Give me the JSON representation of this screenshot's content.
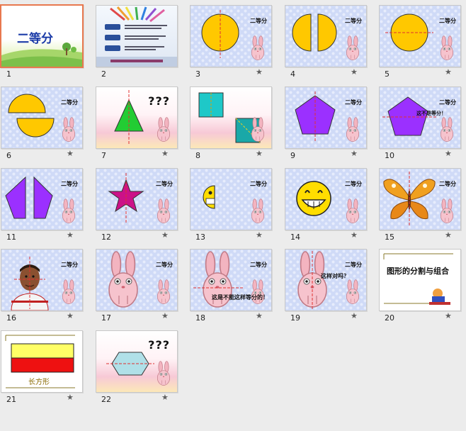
{
  "slides": [
    {
      "number": "1",
      "kind": "title",
      "title_text": "二等分",
      "selected": true,
      "has_anim": false
    },
    {
      "number": "2",
      "kind": "menu",
      "selected": false,
      "has_anim": false
    },
    {
      "number": "3",
      "kind": "circle-whole",
      "corner_label": "二等分",
      "selected": false,
      "has_anim": true
    },
    {
      "number": "4",
      "kind": "circle-split-v",
      "corner_label": "二等分",
      "selected": false,
      "has_anim": true
    },
    {
      "number": "5",
      "kind": "circle-h",
      "corner_label": "二等分",
      "selected": false,
      "has_anim": true
    },
    {
      "number": "6",
      "kind": "circle-split-h",
      "corner_label": "二等分",
      "selected": false,
      "has_anim": true
    },
    {
      "number": "7",
      "kind": "triangle",
      "corner_label": "???",
      "selected": false,
      "has_anim": true
    },
    {
      "number": "8",
      "kind": "squares",
      "selected": false,
      "has_anim": true
    },
    {
      "number": "9",
      "kind": "pentagon",
      "corner_label": "二等分",
      "selected": false,
      "has_anim": true
    },
    {
      "number": "10",
      "kind": "pentagon-h",
      "corner_label": "二等分",
      "mid_label": "这不是等分！",
      "selected": false,
      "has_anim": true
    },
    {
      "number": "11",
      "kind": "pentagon-split",
      "corner_label": "二等分",
      "selected": false,
      "has_anim": true
    },
    {
      "number": "12",
      "kind": "star",
      "corner_label": "二等分",
      "selected": false,
      "has_anim": true
    },
    {
      "number": "13",
      "kind": "smiley-half",
      "corner_label": "二等分",
      "selected": false,
      "has_anim": true
    },
    {
      "number": "14",
      "kind": "smiley",
      "corner_label": "二等分",
      "selected": false,
      "has_anim": true
    },
    {
      "number": "15",
      "kind": "butterfly",
      "corner_label": "二等分",
      "selected": false,
      "has_anim": true
    },
    {
      "number": "16",
      "kind": "face",
      "corner_label": "二等分",
      "selected": false,
      "has_anim": true
    },
    {
      "number": "17",
      "kind": "big-bunny",
      "corner_label": "二等分",
      "selected": false,
      "has_anim": true
    },
    {
      "number": "18",
      "kind": "big-bunny-h",
      "corner_label": "二等分",
      "bottom_label": "这是不能这样等分的！",
      "selected": false,
      "has_anim": true
    },
    {
      "number": "19",
      "kind": "big-bunny-v",
      "corner_label": "二等分",
      "mid_label": "这样对吗？",
      "selected": false,
      "has_anim": true
    },
    {
      "number": "20",
      "kind": "section",
      "title_text": "图形的分割与组合",
      "selected": false,
      "has_anim": true
    },
    {
      "number": "21",
      "kind": "rectangle",
      "bottom_label": "长方形",
      "selected": false,
      "has_anim": true
    },
    {
      "number": "22",
      "kind": "hexagon",
      "corner_label": "???",
      "selected": false,
      "has_anim": true
    }
  ],
  "anim_icon": "★",
  "colors": {
    "selection": "#e8784e",
    "yellow": "#ffc800",
    "purple": "#9b30ff",
    "pattern": "#cfdaf7"
  }
}
